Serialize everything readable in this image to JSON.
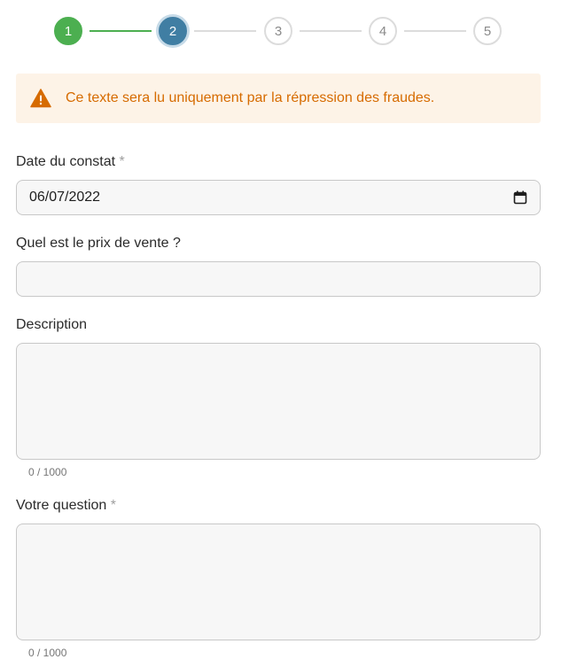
{
  "stepper": {
    "steps": [
      {
        "label": "1",
        "state": "done"
      },
      {
        "label": "2",
        "state": "active"
      },
      {
        "label": "3",
        "state": "todo"
      },
      {
        "label": "4",
        "state": "todo"
      },
      {
        "label": "5",
        "state": "todo"
      }
    ]
  },
  "alert": {
    "icon": "warning-icon",
    "text": "Ce texte sera lu uniquement par la répression des fraudes.",
    "color": "#d66b00",
    "background": "#fdf3e7"
  },
  "form": {
    "date": {
      "label": "Date du constat",
      "required_mark": "*",
      "value": "06/07/2022",
      "icon": "calendar-icon"
    },
    "price": {
      "label": "Quel est le prix de vente ?",
      "value": ""
    },
    "description": {
      "label": "Description",
      "value": "",
      "counter": "0 / 1000"
    },
    "question": {
      "label": "Votre question",
      "required_mark": "*",
      "value": "",
      "counter": "0 / 1000"
    }
  },
  "colors": {
    "step_done": "#4caf50",
    "step_active": "#407ea3",
    "step_todo_border": "#dcdcdc"
  }
}
